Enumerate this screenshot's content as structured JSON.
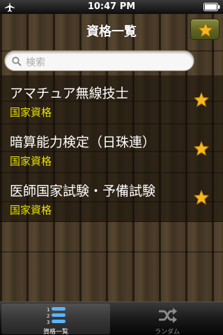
{
  "status_bar": {
    "time": "10:47 PM",
    "icons": [
      "airplane-icon",
      "battery-icon"
    ]
  },
  "nav": {
    "title": "資格一覧",
    "favorites_icon": "star-icon"
  },
  "search": {
    "placeholder": "検索",
    "icon": "search-icon"
  },
  "list": {
    "items": [
      {
        "name": "アマチュア無線技士",
        "category": "国家資格",
        "favorite": true
      },
      {
        "name": "暗算能力検定（日珠連）",
        "category": "国家資格",
        "favorite": true
      },
      {
        "name": "医師国家試験・予備試験",
        "category": "国家資格",
        "favorite": true
      }
    ]
  },
  "tabbar": {
    "tabs": [
      {
        "label": "資格一覧",
        "icon": "numbered-list-icon",
        "selected": true
      },
      {
        "label": "ランダム",
        "icon": "shuffle-icon",
        "selected": false
      }
    ]
  },
  "colors": {
    "category_text": "#e8e100",
    "star": "#f5b720",
    "fav_button": "#5f6522"
  }
}
